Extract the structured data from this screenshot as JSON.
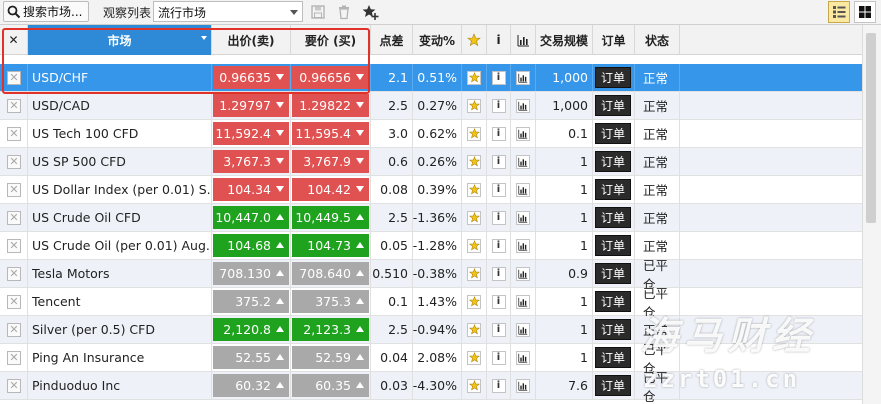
{
  "toolbar": {
    "search_label": "搜索市场...",
    "watchlist_label": "观察列表",
    "watchlist_value": "流行市场"
  },
  "columns": {
    "close": "✕",
    "market": "市场",
    "sell": "出价(卖)",
    "buy": "要价 (买)",
    "spread": "点差",
    "change": "变动%",
    "fav": "☆",
    "info": "i",
    "chart": "chart",
    "size": "交易规模",
    "order": "订单",
    "status": "状态"
  },
  "rows": [
    {
      "market": "USD/CHF",
      "sell": "0.96635",
      "buy": "0.96656",
      "spread": "2.1",
      "change": "0.51%",
      "size": "1,000",
      "order": "订单",
      "status": "正常",
      "color": "red",
      "selected": true
    },
    {
      "market": "USD/CAD",
      "sell": "1.29797",
      "buy": "1.29822",
      "spread": "2.5",
      "change": "0.27%",
      "size": "1,000",
      "order": "订单",
      "status": "正常",
      "color": "red"
    },
    {
      "market": "US Tech 100 CFD",
      "sell": "11,592.4",
      "buy": "11,595.4",
      "spread": "3.0",
      "change": "0.62%",
      "size": "0.1",
      "order": "订单",
      "status": "正常",
      "color": "red"
    },
    {
      "market": "US SP 500 CFD",
      "sell": "3,767.3",
      "buy": "3,767.9",
      "spread": "0.6",
      "change": "0.26%",
      "size": "1",
      "order": "订单",
      "status": "正常",
      "color": "red"
    },
    {
      "market": "US Dollar Index (per 0.01) S...",
      "sell": "104.34",
      "buy": "104.42",
      "spread": "0.08",
      "change": "0.39%",
      "size": "1",
      "order": "订单",
      "status": "正常",
      "color": "red"
    },
    {
      "market": "US Crude Oil CFD",
      "sell": "10,447.0",
      "buy": "10,449.5",
      "spread": "2.5",
      "change": "-1.36%",
      "size": "1",
      "order": "订单",
      "status": "正常",
      "color": "green"
    },
    {
      "market": "US Crude Oil (per 0.01) Aug...",
      "sell": "104.68",
      "buy": "104.73",
      "spread": "0.05",
      "change": "-1.28%",
      "size": "1",
      "order": "订单",
      "status": "正常",
      "color": "green"
    },
    {
      "market": "Tesla Motors",
      "sell": "708.130",
      "buy": "708.640",
      "spread": "0.510",
      "change": "-0.38%",
      "size": "0.9",
      "order": "订单",
      "status": "已平仓",
      "color": "gray"
    },
    {
      "market": "Tencent",
      "sell": "375.2",
      "buy": "375.3",
      "spread": "0.1",
      "change": "1.43%",
      "size": "1",
      "order": "订单",
      "status": "已平仓",
      "color": "gray"
    },
    {
      "market": "Silver (per 0.5) CFD",
      "sell": "2,120.8",
      "buy": "2,123.3",
      "spread": "2.5",
      "change": "-0.94%",
      "size": "1",
      "order": "订单",
      "status": "正常",
      "color": "green"
    },
    {
      "market": "Ping An Insurance",
      "sell": "52.55",
      "buy": "52.59",
      "spread": "0.04",
      "change": "2.08%",
      "size": "1",
      "order": "订单",
      "status": "已平仓",
      "color": "gray"
    },
    {
      "market": "Pinduoduo Inc",
      "sell": "60.32",
      "buy": "60.35",
      "spread": "0.03",
      "change": "-4.30%",
      "size": "7.6",
      "order": "订单",
      "status": "已平仓",
      "color": "gray"
    }
  ],
  "watermark": {
    "brand": "海马财经",
    "url": "zzrt01.cn"
  },
  "colors": {
    "selected_row": "#3596ea",
    "price_red": "#e05151",
    "price_green": "#1fa31f",
    "price_gray": "#a9a9a9",
    "highlight_border": "#e0312b"
  }
}
